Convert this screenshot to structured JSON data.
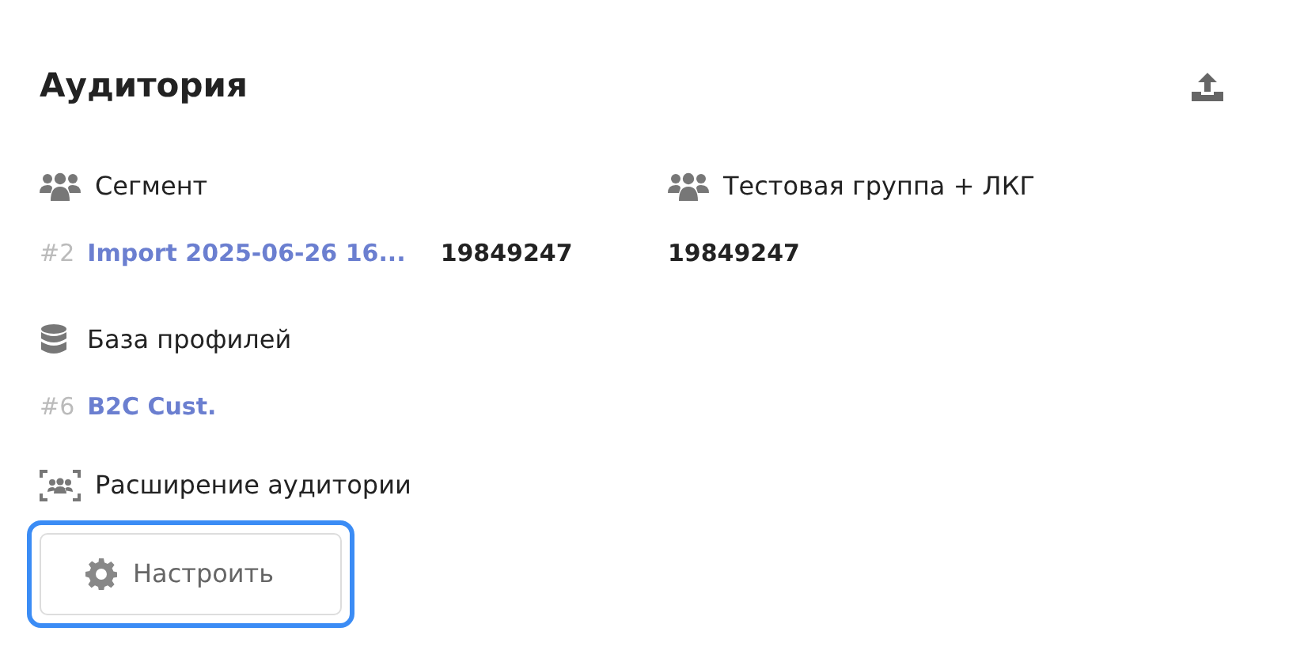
{
  "title": "Аудитория",
  "segment": {
    "label": "Сегмент",
    "number": "#2",
    "name": "Import 2025-06-26 16...",
    "count": "19849247"
  },
  "test_group": {
    "label": "Тестовая группа + ЛКГ",
    "count": "19849247"
  },
  "profile_base": {
    "label": "База профилей",
    "number": "#6",
    "name": "B2C Cust."
  },
  "expansion": {
    "label": "Расширение аудитории",
    "button": {
      "label": "Настроить",
      "focused": true
    }
  }
}
